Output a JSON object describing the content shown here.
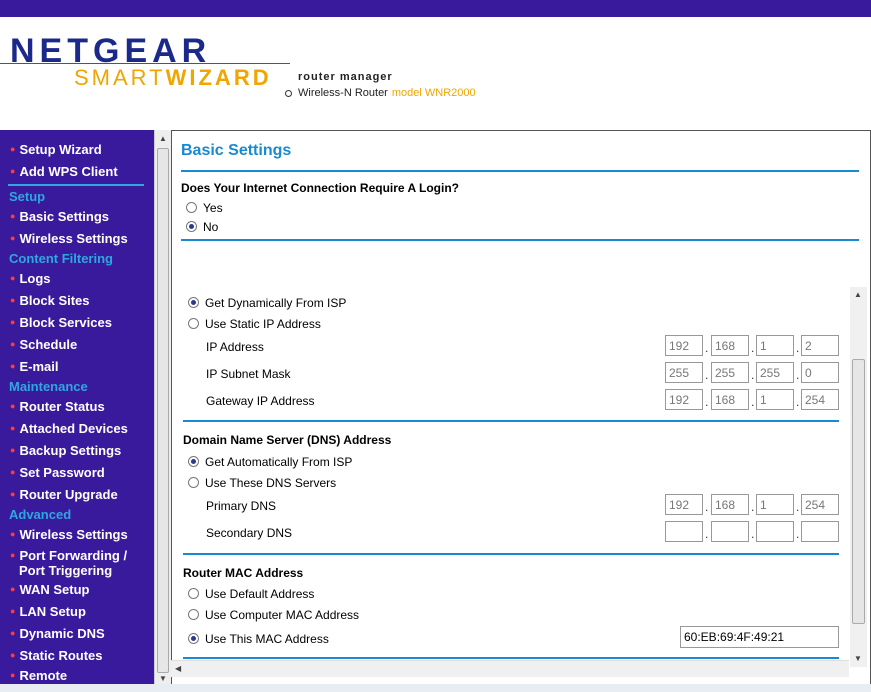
{
  "header": {
    "brand": "NETGEAR",
    "smart": "SMART",
    "wizard": "WIZARD",
    "subtitle": "router manager",
    "product": "Wireless-N Router",
    "model": "model WNR2000"
  },
  "sidebar": {
    "top_items": [
      "Setup Wizard",
      "Add WPS Client"
    ],
    "sections": {
      "setup": "Setup",
      "content_filtering": "Content Filtering",
      "maintenance": "Maintenance",
      "advanced": "Advanced"
    },
    "setup_items": [
      "Basic Settings",
      "Wireless Settings"
    ],
    "cf_items": [
      "Logs",
      "Block Sites",
      "Block Services",
      "Schedule",
      "E-mail"
    ],
    "maint_items": [
      "Router Status",
      "Attached Devices",
      "Backup Settings",
      "Set Password",
      "Router Upgrade"
    ],
    "adv_items": [
      "Wireless Settings",
      "Port Forwarding /",
      "Port Triggering",
      "WAN Setup",
      "LAN Setup",
      "Dynamic DNS",
      "Static Routes",
      "Remote"
    ]
  },
  "content": {
    "title": "Basic Settings",
    "login_question": "Does Your Internet Connection Require A Login?",
    "login_yes": "Yes",
    "login_no": "No",
    "ip_dynamic": "Get Dynamically From ISP",
    "ip_static": "Use Static IP Address",
    "ip_address_label": "IP Address",
    "ip_address": [
      "192",
      "168",
      "1",
      "2"
    ],
    "subnet_label": "IP Subnet Mask",
    "subnet": [
      "255",
      "255",
      "255",
      "0"
    ],
    "gateway_label": "Gateway IP Address",
    "gateway": [
      "192",
      "168",
      "1",
      "254"
    ],
    "dns_heading": "Domain Name Server (DNS) Address",
    "dns_auto": "Get Automatically From ISP",
    "dns_manual": "Use These DNS Servers",
    "primary_dns_label": "Primary DNS",
    "primary_dns": [
      "192",
      "168",
      "1",
      "254"
    ],
    "secondary_dns_label": "Secondary DNS",
    "mac_heading": "Router MAC Address",
    "mac_default": "Use Default Address",
    "mac_computer": "Use Computer MAC Address",
    "mac_this": "Use This MAC Address",
    "mac_value": "60:EB:69:4F:49:21"
  },
  "colors": {
    "nav_bg": "#3a1a9c",
    "section": "#2ea7e0",
    "title": "#1a8ad0",
    "bullet": "#ff3b3b"
  }
}
